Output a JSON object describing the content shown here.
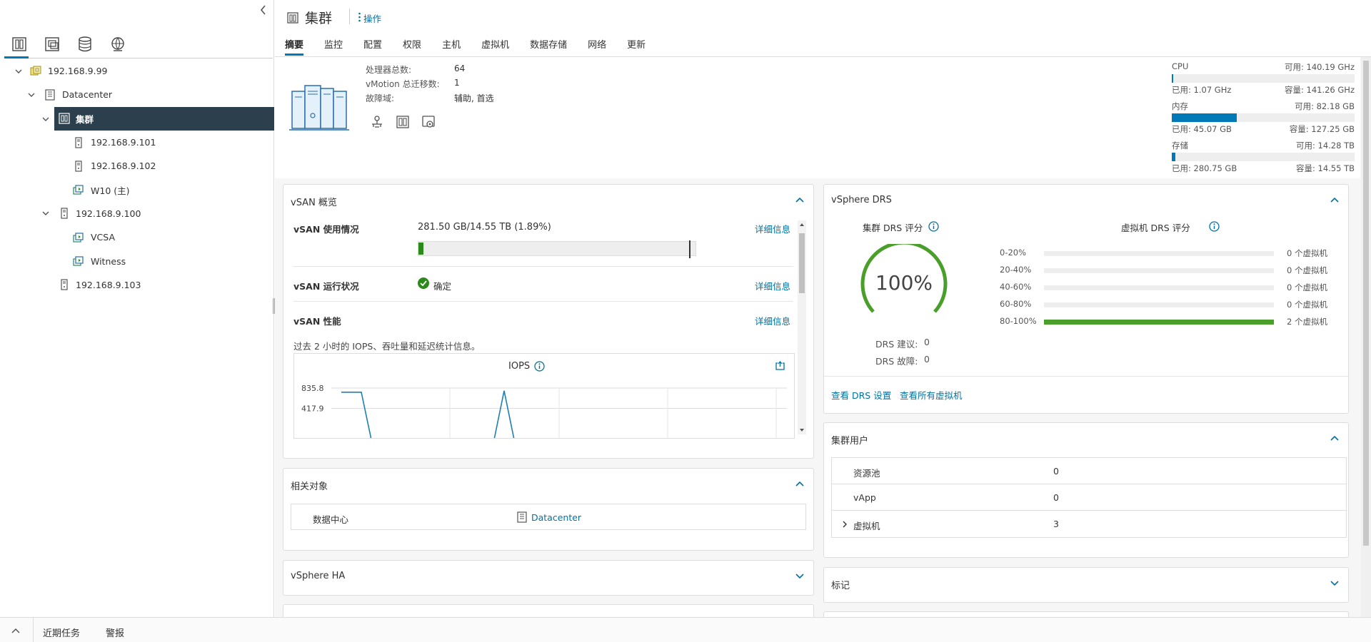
{
  "sidebar": {
    "tree": [
      {
        "label": "192.168.9.99",
        "icon": "vcenter-icon",
        "expanded": true
      },
      {
        "label": "Datacenter",
        "icon": "datacenter-icon",
        "expanded": true
      },
      {
        "label": "集群",
        "icon": "cluster-icon",
        "expanded": true,
        "selected": true
      },
      {
        "label": "192.168.9.101",
        "icon": "host-icon"
      },
      {
        "label": "192.168.9.102",
        "icon": "host-icon"
      },
      {
        "label": "W10 (主)",
        "icon": "vm-icon"
      },
      {
        "label": "192.168.9.100",
        "icon": "host-icon",
        "expanded": true
      },
      {
        "label": "VCSA",
        "icon": "vm-icon"
      },
      {
        "label": "Witness",
        "icon": "vm-icon"
      },
      {
        "label": "192.168.9.103",
        "icon": "host-icon"
      }
    ]
  },
  "bottom": {
    "recent_tasks": "近期任务",
    "alarms": "警报"
  },
  "header": {
    "title": "集群",
    "actions": "操作",
    "tabs": [
      "摘要",
      "监控",
      "配置",
      "权限",
      "主机",
      "虚拟机",
      "数据存储",
      "网络",
      "更新"
    ]
  },
  "summary": {
    "labels": {
      "cpu_total": "处理器总数:",
      "vmotion": "vMotion 总迁移数:",
      "fault_domain": "故障域:"
    },
    "values": {
      "cpu_total": "64",
      "vmotion": "1",
      "fault_domain": "辅助, 首选"
    },
    "resources": {
      "cpu": {
        "label": "CPU",
        "free": "可用: 140.19 GHz",
        "used": "已用: 1.07 GHz",
        "capacity": "容量: 141.26 GHz",
        "pct": 0.76
      },
      "memory": {
        "label": "内存",
        "free": "可用: 82.18 GB",
        "used": "已用: 45.07 GB",
        "capacity": "容量: 127.25 GB",
        "pct": 35.4
      },
      "storage": {
        "label": "存储",
        "free": "可用: 14.28 TB",
        "used": "已用: 280.75 GB",
        "capacity": "容量: 14.55 TB",
        "pct": 1.9
      }
    }
  },
  "vsan": {
    "title": "vSAN 概览",
    "usage_label": "vSAN 使用情况",
    "usage_value": "281.50 GB/14.55 TB (1.89%)",
    "usage_pct": 1.89,
    "health_label": "vSAN 运行状况",
    "health_value": "确定",
    "perf_label": "vSAN 性能",
    "details_link": "详细信息",
    "perf_desc": "过去 2 小时的 IOPS、吞吐量和延迟统计信息。",
    "iops_title": "IOPS"
  },
  "chart_data": {
    "type": "line",
    "title": "IOPS",
    "y_ticks": [
      "835.8",
      "417.9"
    ],
    "series": [
      {
        "values": [
          750,
          750,
          0,
          null,
          780,
          0
        ]
      }
    ]
  },
  "related": {
    "title": "相关对象",
    "rows": [
      {
        "label": "数据中心",
        "value": "Datacenter"
      }
    ]
  },
  "ha": {
    "title": "vSphere HA"
  },
  "drs": {
    "title": "vSphere DRS",
    "cluster_score_title": "集群 DRS 评分",
    "vm_score_title": "虚拟机 DRS 评分",
    "score": "100%",
    "recommendations_label": "DRS 建议:",
    "recommendations": "0",
    "faults_label": "DRS 故障:",
    "faults": "0",
    "histogram": [
      {
        "range": "0-20%",
        "count": "0 个虚拟机",
        "fraction": 0
      },
      {
        "range": "20-40%",
        "count": "0 个虚拟机",
        "fraction": 0
      },
      {
        "range": "40-60%",
        "count": "0 个虚拟机",
        "fraction": 0
      },
      {
        "range": "60-80%",
        "count": "0 个虚拟机",
        "fraction": 0
      },
      {
        "range": "80-100%",
        "count": "2 个虚拟机",
        "fraction": 1
      }
    ],
    "view_settings": "查看 DRS 设置",
    "view_vms": "查看所有虚拟机"
  },
  "consumers": {
    "title": "集群用户",
    "rows": [
      {
        "label": "资源池",
        "value": "0"
      },
      {
        "label": "vApp",
        "value": "0"
      },
      {
        "label": "虚拟机",
        "value": "3",
        "expandable": true
      }
    ]
  },
  "tags": {
    "title": "标记"
  },
  "colors": {
    "accent": "#0079b8",
    "selected_bg": "#2b3f4d",
    "ok": "#2a8a1a",
    "drs_green": "#4a9e2a"
  }
}
